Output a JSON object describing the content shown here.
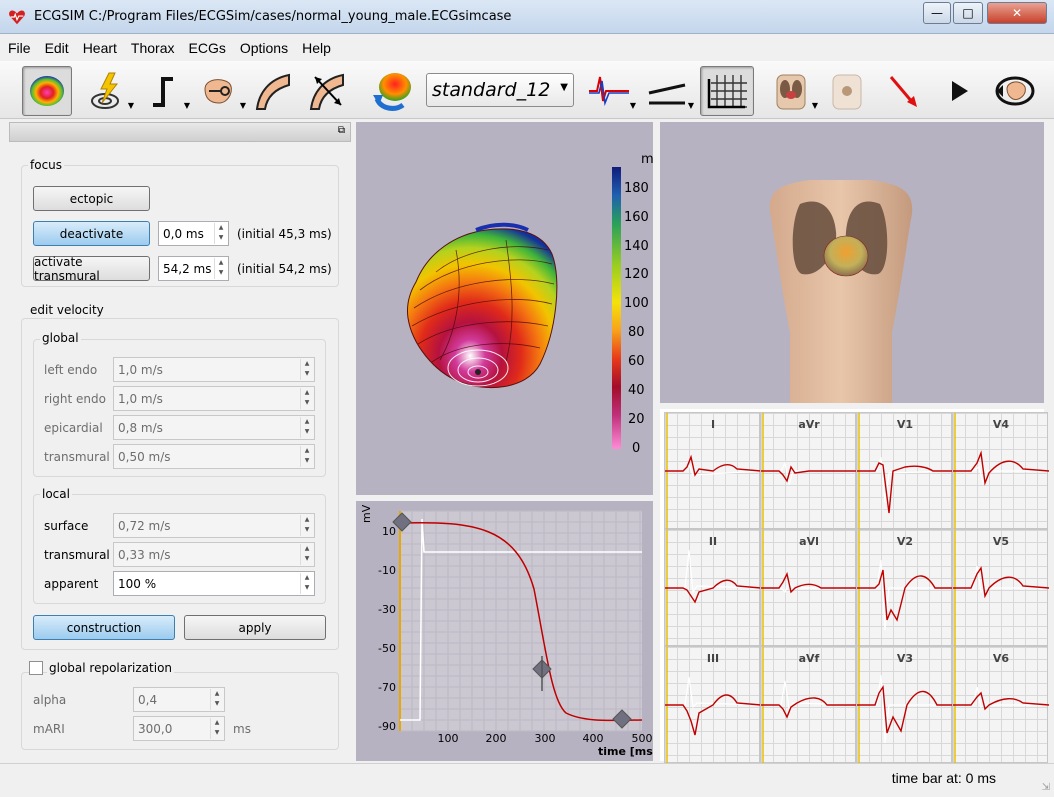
{
  "window": {
    "app": "ECGSIM",
    "title": "ECGSIM  C:/Program Files/ECGSim/cases/normal_young_male.ECGsimcase"
  },
  "menu": [
    "File",
    "Edit",
    "Heart",
    "Thorax",
    "ECGs",
    "Options",
    "Help"
  ],
  "toolbar": {
    "lead_set": "standard_12"
  },
  "focus": {
    "label": "focus",
    "ectopic": "ectopic",
    "deactivate": "deactivate",
    "deactivate_value": "0,0 ms",
    "deactivate_initial": "(initial 45,3 ms)",
    "activate": "activate transmural",
    "activate_value": "54,2 ms",
    "activate_initial": "(initial 54,2 ms)"
  },
  "edit_velocity": {
    "label": "edit velocity",
    "global": {
      "label": "global",
      "rows": [
        {
          "label": "left endo",
          "value": "1,0 m/s"
        },
        {
          "label": "right endo",
          "value": "1,0 m/s"
        },
        {
          "label": "epicardial",
          "value": "0,8 m/s"
        },
        {
          "label": "transmural",
          "value": "0,50 m/s"
        }
      ]
    },
    "local": {
      "label": "local",
      "rows": [
        {
          "label": "surface",
          "value": "0,72 m/s"
        },
        {
          "label": "transmural",
          "value": "0,33 m/s"
        },
        {
          "label": "apparent",
          "value": "100 %"
        }
      ]
    },
    "construction": "construction",
    "apply": "apply"
  },
  "repolarization": {
    "label": "global repolarization",
    "checked": false,
    "alpha_label": "alpha",
    "alpha": "0,4",
    "mari_label": "mARI",
    "mari": "300,0",
    "mari_unit": "ms"
  },
  "colorbar": {
    "unit": "m",
    "ticks": [
      "180",
      "160",
      "140",
      "120",
      "100",
      "80",
      "60",
      "40",
      "20",
      "0"
    ]
  },
  "ap_chart": {
    "ylabel": "mV",
    "xlabel": "time [ms]",
    "yticks": [
      "10",
      "-10",
      "-30",
      "-50",
      "-70",
      "-90"
    ],
    "xticks": [
      "100",
      "200",
      "300",
      "400",
      "500"
    ]
  },
  "leads": [
    "I",
    "aVr",
    "V1",
    "V4",
    "II",
    "aVl",
    "V2",
    "V5",
    "III",
    "aVf",
    "V3",
    "V6"
  ],
  "status": "time bar at: 0 ms",
  "colors": {
    "trace": "#c00000",
    "pane": "#b7b2c1",
    "button_blue": "#9ccbef"
  }
}
